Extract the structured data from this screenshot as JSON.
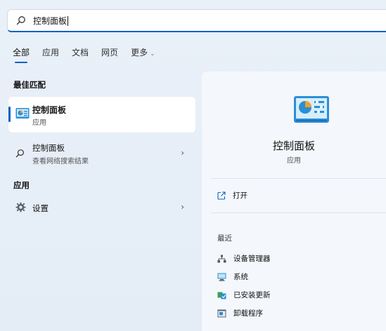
{
  "search": {
    "query": "控制面板"
  },
  "tabs": [
    {
      "label": "全部"
    },
    {
      "label": "应用"
    },
    {
      "label": "文档"
    },
    {
      "label": "网页"
    },
    {
      "label": "更多"
    }
  ],
  "best_match": {
    "header": "最佳匹配",
    "title": "控制面板",
    "subtitle": "应用"
  },
  "web_result": {
    "title": "控制面板",
    "subtitle": "查看网络搜索结果"
  },
  "apps_section": {
    "header": "应用",
    "items": [
      {
        "label": "设置"
      }
    ]
  },
  "detail": {
    "name": "控制面板",
    "type": "应用",
    "open_label": "打开",
    "recent_header": "最近",
    "recent": [
      {
        "label": "设备管理器",
        "icon": "device-manager-icon"
      },
      {
        "label": "系统",
        "icon": "system-icon"
      },
      {
        "label": "已安装更新",
        "icon": "installed-updates-icon"
      },
      {
        "label": "卸载程序",
        "icon": "uninstall-program-icon"
      }
    ]
  },
  "colors": {
    "accent": "#0a5fc2",
    "icon_blue": "#2a8fd6",
    "icon_orange": "#f0a02a"
  }
}
